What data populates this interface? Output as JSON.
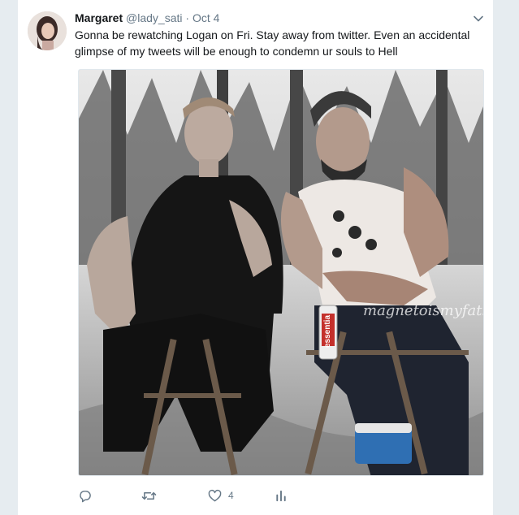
{
  "tweet": {
    "author_name": "Margaret",
    "author_handle": "@lady_sati",
    "separator": "·",
    "date": "Oct 4",
    "text": "Gonna be rewatching Logan on Fri. Stay away from twitter. Even an accidental glimpse of my tweets will be enough to condemn ur souls to Hell",
    "media": {
      "watermark_text": "magnetoismyfather",
      "bottle_label": "essentia"
    },
    "actions": {
      "reply_icon": "reply-icon",
      "retweet_icon": "retweet-icon",
      "like_icon": "heart-icon",
      "like_count": "4",
      "analytics_icon": "analytics-icon"
    }
  },
  "colors": {
    "page_bg": "#e6ecf0",
    "card_bg": "#ffffff",
    "text_primary": "#14171a",
    "text_secondary": "#657786"
  }
}
